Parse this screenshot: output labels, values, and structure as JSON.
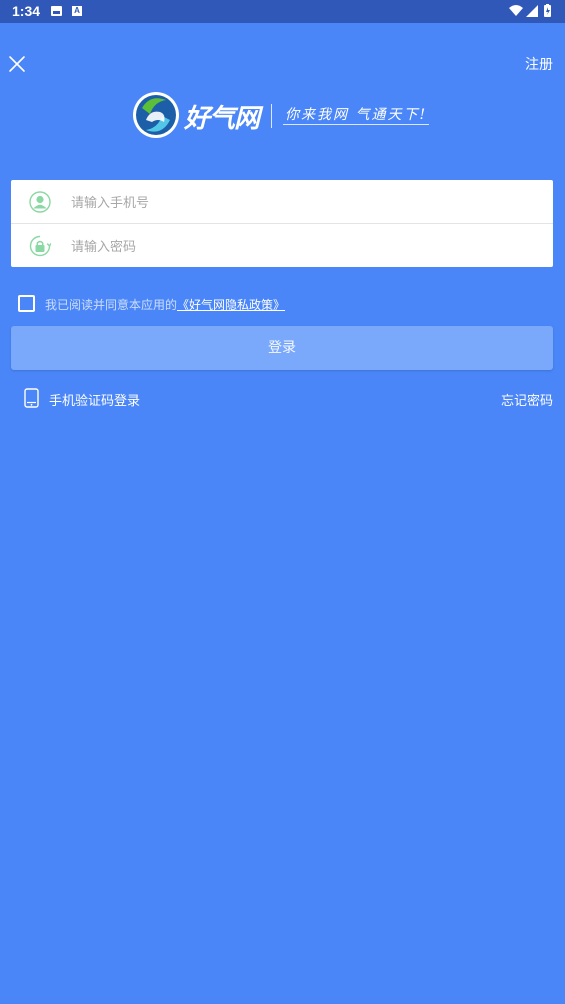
{
  "status_bar": {
    "time": "1:34",
    "icons": [
      "image-icon",
      "font-a-icon",
      "wifi-icon",
      "signal-icon",
      "battery-icon"
    ]
  },
  "header": {
    "close_icon": "close-icon",
    "register_label": "注册"
  },
  "logo": {
    "brand": "好气网",
    "slogan": "你来我网 气通天下!"
  },
  "form": {
    "phone": {
      "placeholder": "请输入手机号",
      "value": "",
      "icon": "user-icon"
    },
    "password": {
      "placeholder": "请输入密码",
      "value": "",
      "icon": "lock-icon"
    }
  },
  "agreement": {
    "checked": false,
    "text": "我已阅读并同意本应用的",
    "link": "《好气网隐私政策》"
  },
  "login_button": "登录",
  "sms_login": {
    "icon": "phone-icon",
    "label": "手机验证码登录"
  },
  "forgot_password": "忘记密码",
  "colors": {
    "background": "#4a86f8",
    "status_bar": "#2f58b8",
    "button": "#7aa9fb",
    "field_icon": "#8ad8a3"
  }
}
